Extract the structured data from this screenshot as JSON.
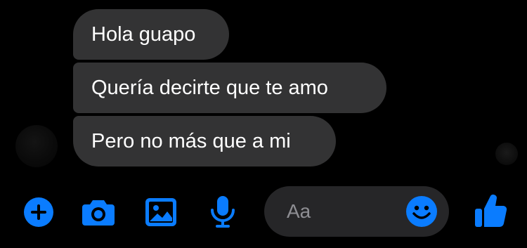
{
  "messages": [
    {
      "text": "Hola guapo"
    },
    {
      "text": "Quería decirte que te amo"
    },
    {
      "text": "Pero no más que a mi"
    }
  ],
  "composer": {
    "placeholder": "Aa"
  },
  "toolbar": {
    "icons": [
      "plus-circle-icon",
      "camera-icon",
      "gallery-icon",
      "microphone-icon",
      "emoji-icon",
      "thumbs-up-icon"
    ]
  },
  "colors": {
    "accent": "#0a7cff",
    "bubble": "#333334",
    "composer": "#262628",
    "background": "#000000",
    "placeholder": "#8e8e93"
  }
}
